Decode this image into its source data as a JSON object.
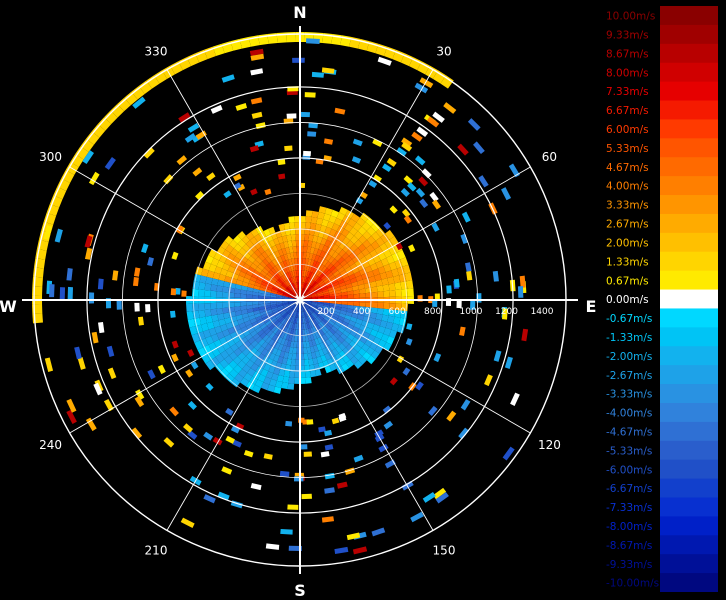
{
  "radar": {
    "cardinals": {
      "north": "N",
      "east": "E",
      "south": "S",
      "west": "W"
    },
    "azimuth_labels": [
      "30",
      "60",
      "120",
      "150",
      "210",
      "240",
      "300",
      "330"
    ],
    "azimuths_deg": [
      30,
      60,
      120,
      150,
      210,
      240,
      300,
      330
    ],
    "range_labels": [
      "200",
      "400",
      "600",
      "800",
      "1000",
      "1200",
      "1400"
    ],
    "range_values": [
      200,
      400,
      600,
      800,
      1000,
      1200,
      1400
    ],
    "max_range": 1600,
    "colors": {
      "ring": "#ffffff",
      "axis": "#ffffff",
      "center_marker": "#ffffff"
    }
  },
  "colorbar": {
    "labels": [
      "10.00m/s",
      "9.33m/s",
      "8.67m/s",
      "8.00m/s",
      "7.33m/s",
      "6.67m/s",
      "6.00m/s",
      "5.33m/s",
      "4.67m/s",
      "4.00m/s",
      "3.33m/s",
      "2.67m/s",
      "2.00m/s",
      "1.33m/s",
      "0.67m/s",
      "0.00m/s",
      "-0.67m/s",
      "-1.33m/s",
      "-2.00m/s",
      "-2.67m/s",
      "-3.33m/s",
      "-4.00m/s",
      "-4.67m/s",
      "-5.33m/s",
      "-6.00m/s",
      "-6.67m/s",
      "-7.33m/s",
      "-8.00m/s",
      "-8.67m/s",
      "-9.33m/s",
      "-10.00m/s"
    ],
    "colors": [
      "#8a0000",
      "#a00000",
      "#b80000",
      "#d00000",
      "#e60000",
      "#f51a00",
      "#ff3a00",
      "#ff5500",
      "#ff6a00",
      "#ff7f00",
      "#ff9500",
      "#ffab00",
      "#ffc000",
      "#ffd500",
      "#ffea00",
      "#ffffff",
      "#00d8ff",
      "#00c4f5",
      "#12b2ee",
      "#1ea2e8",
      "#2992e2",
      "#3082dc",
      "#2f70d4",
      "#2a5ecc",
      "#2050c8",
      "#1240cc",
      "#0830d0",
      "#0020c8",
      "#0018b0",
      "#001098",
      "#000880"
    ]
  }
}
